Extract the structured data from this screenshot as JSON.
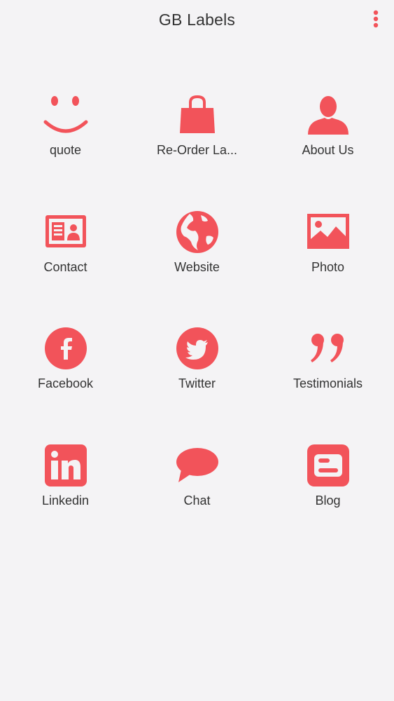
{
  "app": {
    "title": "GB Labels",
    "accent_color": "#f2535a",
    "menu_icon": "more-vertical-icon"
  },
  "tiles": [
    {
      "label": "quote",
      "icon": "smiley-icon"
    },
    {
      "label": "Re-Order La...",
      "icon": "shopping-bag-icon"
    },
    {
      "label": "About Us",
      "icon": "person-icon"
    },
    {
      "label": "Contact",
      "icon": "contact-card-icon"
    },
    {
      "label": "Website",
      "icon": "globe-icon"
    },
    {
      "label": "Photo",
      "icon": "photo-icon"
    },
    {
      "label": "Facebook",
      "icon": "facebook-icon"
    },
    {
      "label": "Twitter",
      "icon": "twitter-icon"
    },
    {
      "label": "Testimonials",
      "icon": "quote-marks-icon"
    },
    {
      "label": "Linkedin",
      "icon": "linkedin-icon"
    },
    {
      "label": "Chat",
      "icon": "chat-bubble-icon"
    },
    {
      "label": "Blog",
      "icon": "blogger-icon"
    }
  ]
}
